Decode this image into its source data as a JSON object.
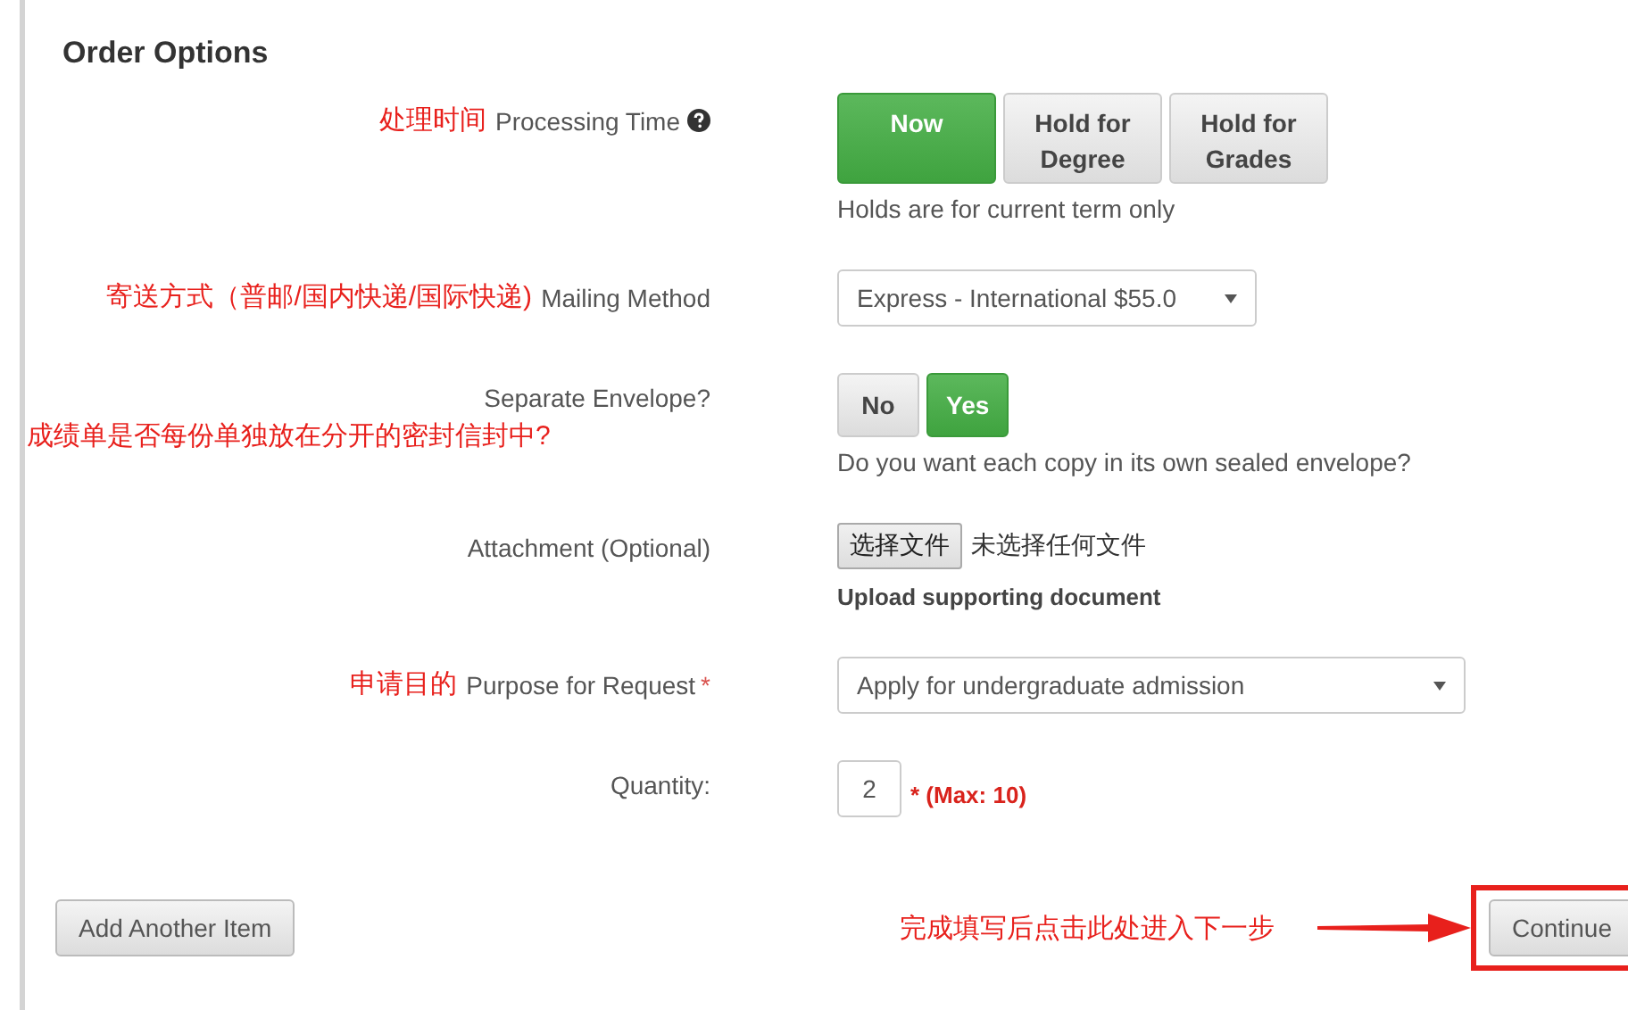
{
  "heading": "Order Options",
  "fields": [
    {
      "kind": "choice",
      "annotation": "处理时间",
      "label": "Processing Time",
      "help_icon": true,
      "options": [
        {
          "label": "Now",
          "selected": true
        },
        {
          "label": "Hold for Degree",
          "selected": false
        },
        {
          "label": "Hold for Grades",
          "selected": false
        }
      ],
      "help": "Holds are for current term only"
    },
    {
      "kind": "select",
      "annotation": "寄送方式（普邮/国内快递/国际快递)",
      "label": "Mailing Method",
      "value": "Express - International $55.0"
    },
    {
      "kind": "choice",
      "label": "Separate Envelope?",
      "note_below": "成绩单是否每份单独放在分开的密封信封中?",
      "options": [
        {
          "label": "No",
          "selected": false
        },
        {
          "label": "Yes",
          "selected": true
        }
      ],
      "help": "Do you want each copy in its own sealed envelope?"
    },
    {
      "kind": "file",
      "label": "Attachment (Optional)",
      "button": "选择文件",
      "status": "未选择任何文件",
      "help": "Upload supporting document"
    },
    {
      "kind": "select",
      "annotation": "申请目的",
      "label": "Purpose for Request",
      "required_mark": "*",
      "value": "Apply for undergraduate admission"
    },
    {
      "kind": "number",
      "label": "Quantity:",
      "value": "2",
      "note": "* (Max: 10)"
    }
  ],
  "footer": {
    "add_button": "Add Another Item",
    "callout": "完成填写后点击此处进入下一步",
    "continue_button": "Continue",
    "highlighted": true
  }
}
